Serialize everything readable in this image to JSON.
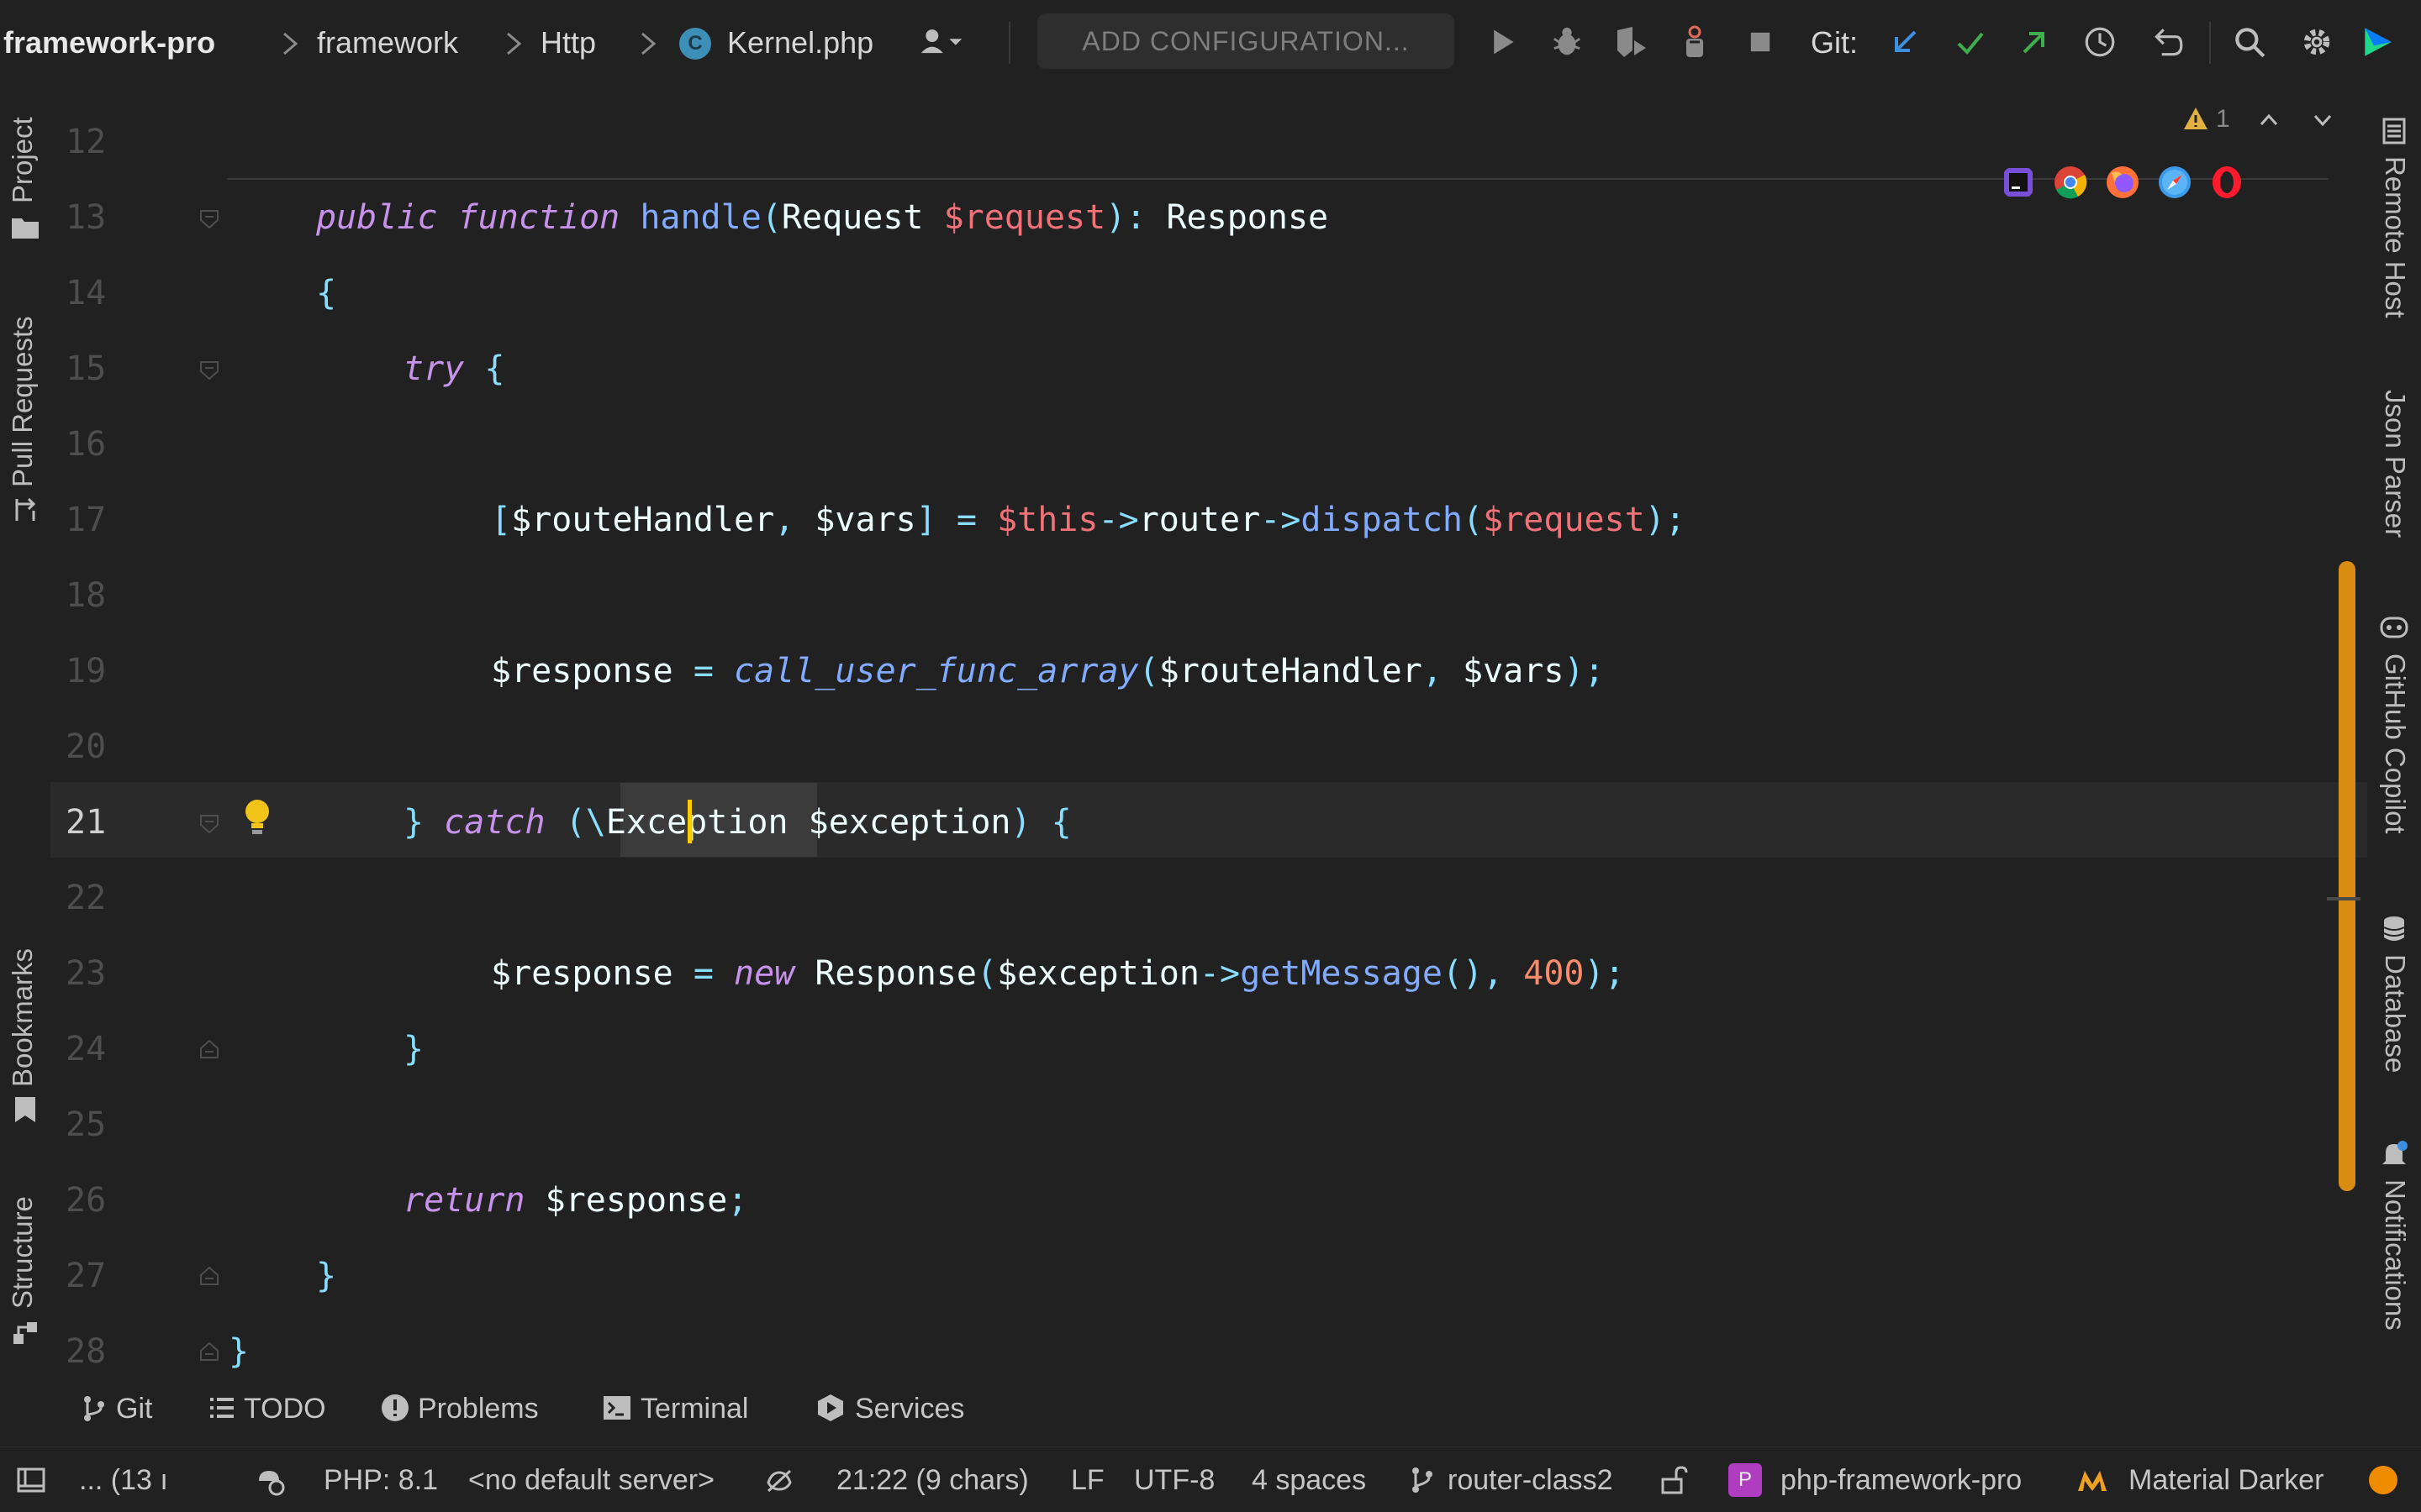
{
  "toolbar": {
    "project": "framework-pro",
    "crumbs": [
      "framework",
      "Http",
      "Kernel.php"
    ],
    "class_badge": "C",
    "config_button": "ADD CONFIGURATION...",
    "git_label": "Git:"
  },
  "editor": {
    "inspection_count": "1",
    "line_numbers": [
      "12",
      "13",
      "14",
      "15",
      "16",
      "17",
      "18",
      "19",
      "20",
      "21",
      "22",
      "23",
      "24",
      "25",
      "26",
      "27",
      "28"
    ],
    "current_line": "21"
  },
  "left_tools": {
    "project": "Project",
    "pull_requests": "Pull Requests",
    "bookmarks": "Bookmarks",
    "structure": "Structure"
  },
  "right_tools": {
    "remote_host": "Remote Host",
    "json_parser": "Json Parser",
    "copilot": "GitHub Copilot",
    "database": "Database",
    "notifications": "Notifications"
  },
  "bottom_tabs": {
    "git": "Git",
    "todo": "TODO",
    "problems": "Problems",
    "terminal": "Terminal",
    "services": "Services"
  },
  "status": {
    "progress": "... (13 ı",
    "php": "PHP: 8.1",
    "server": "<no default server>",
    "position": "21:22 (9 chars)",
    "line_ending": "LF",
    "encoding": "UTF-8",
    "indent": "4 spaces",
    "branch": "router-class2",
    "project_badge": "P",
    "project": "php-framework-pro",
    "theme": "Material Darker"
  },
  "colors": {
    "accent_orange": "#d98c12",
    "keyword": "#c792ea",
    "function": "#82aaff",
    "variable": "#f07178",
    "punctuation": "#89ddff",
    "number": "#f78c6c"
  }
}
